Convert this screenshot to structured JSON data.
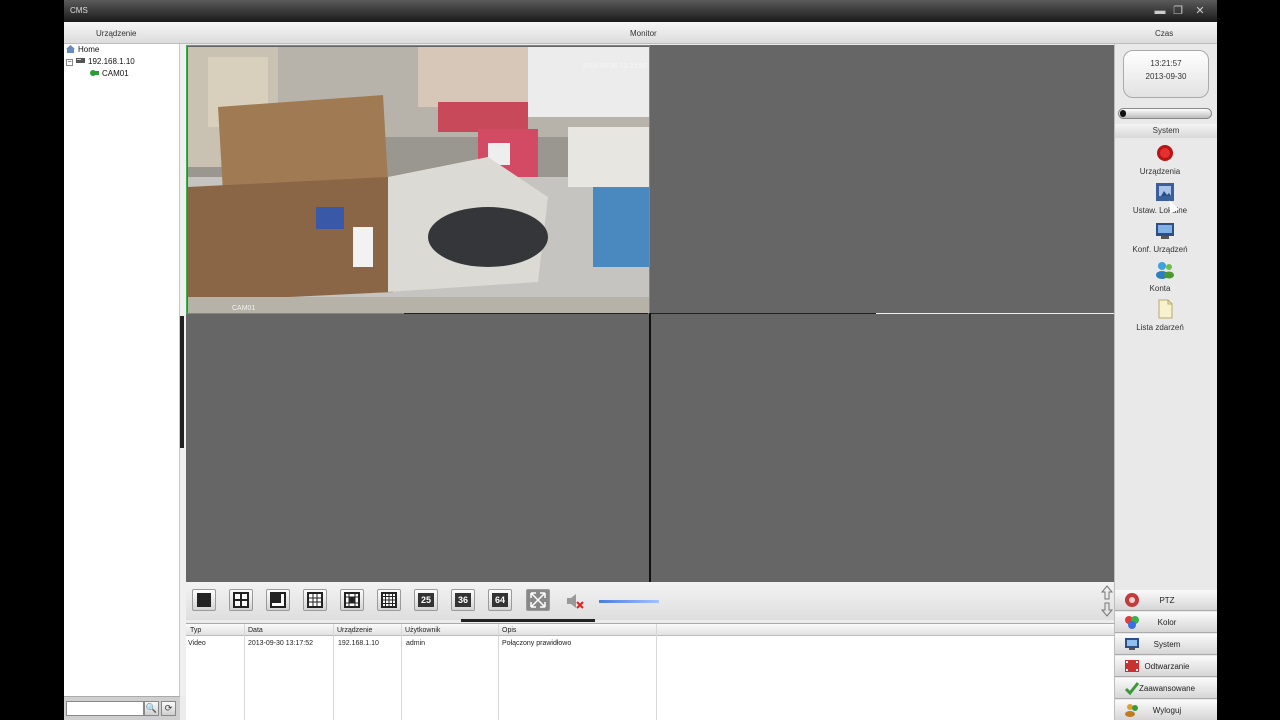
{
  "window": {
    "title": "CMS",
    "minimize": "▬",
    "maximize": "❐",
    "close": "✕"
  },
  "header": {
    "device_tab": "Urządzenie",
    "monitor_tab": "Monitor",
    "time_tab": "Czas"
  },
  "tree": {
    "root": "Home",
    "device": "192.168.1.10",
    "camera": "CAM01"
  },
  "search": {
    "placeholder": "",
    "search_icon": "🔍",
    "refresh_icon": "⟳"
  },
  "video": {
    "timestamp": "2013-09-30 13:21:56",
    "camera_name": "CAM01"
  },
  "toolbar": {
    "layout_25": "25",
    "layout_36": "36",
    "layout_64": "64"
  },
  "log": {
    "columns": [
      "Typ",
      "Data",
      "Urządzenie",
      "Użytkownik",
      "Opis"
    ],
    "rows": [
      {
        "typ": "Video",
        "data": "2013-09-30 13:17:52",
        "device": "192.168.1.10",
        "user": "admin",
        "desc": "Połączony prawidłowo"
      }
    ]
  },
  "clock": {
    "time": "13:21:57",
    "date": "2013-09-30"
  },
  "system": {
    "title": "System",
    "items": [
      {
        "label": "Urządzenia",
        "icon": "record-icon"
      },
      {
        "label": "Ustaw. Lokalne",
        "icon": "local-settings-icon"
      },
      {
        "label": "Konf. Urządzeń",
        "icon": "device-config-icon"
      },
      {
        "label": "Konta",
        "icon": "accounts-icon"
      },
      {
        "label": "Lista zdarzeń",
        "icon": "event-list-icon"
      }
    ]
  },
  "panels": {
    "ptz": "PTZ",
    "color": "Kolor",
    "system": "System",
    "playback": "Odtwarzanie",
    "advanced": "Zaawansowane",
    "logout": "Wyloguj"
  },
  "colors": {
    "active_cell_border": "#3cb44b",
    "grid_bg": "#666666"
  }
}
